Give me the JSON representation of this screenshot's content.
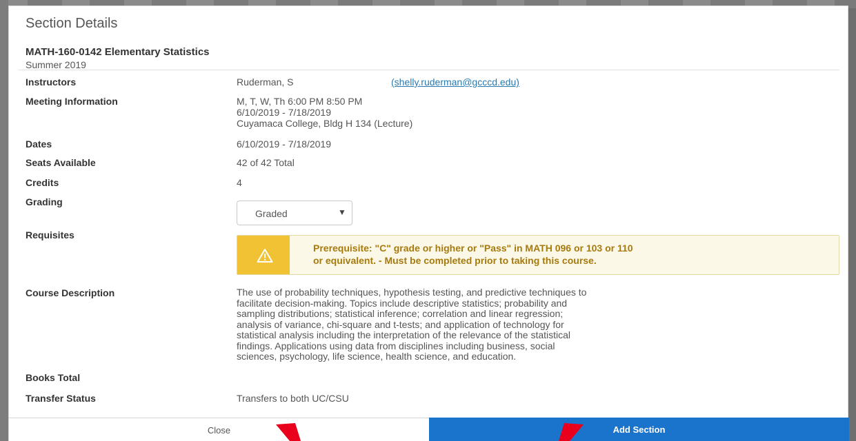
{
  "modal": {
    "title": "Section Details"
  },
  "section": {
    "name": "MATH-160-0142 Elementary Statistics",
    "term": "Summer 2019"
  },
  "details": {
    "instructors": {
      "label": "Instructors",
      "name": "Ruderman, S",
      "email": "(shelly.ruderman@gcccd.edu)"
    },
    "meeting": {
      "label": "Meeting Information",
      "line1": "M, T, W, Th 6:00 PM 8:50 PM",
      "line2": "6/10/2019 - 7/18/2019",
      "line3": "Cuyamaca College, Bldg H 134 (Lecture)"
    },
    "dates": {
      "label": "Dates",
      "value": "6/10/2019 - 7/18/2019"
    },
    "seats": {
      "label": "Seats Available",
      "value": "42 of 42 Total"
    },
    "credits": {
      "label": "Credits",
      "value": "4"
    },
    "grading": {
      "label": "Grading",
      "selected": "Graded"
    },
    "requisites": {
      "label": "Requisites",
      "line1": "Prerequisite: \"C\" grade or higher or \"Pass\" in MATH 096 or 103 or 110",
      "line2": "or equivalent. - Must be completed prior to taking this course."
    },
    "description": {
      "label": "Course Description",
      "lines": [
        "The use of probability techniques, hypothesis testing, and predictive techniques to",
        "facilitate decision-making. Topics include descriptive statistics; probability and",
        "sampling distributions; statistical inference; correlation and linear regression;",
        "analysis of variance, chi-square and t-tests; and application of technology for",
        "statistical analysis including the interpretation of the relevance of the statistical",
        "findings. Applications using data from disciplines including business, social",
        "sciences, psychology, life science, health science, and education."
      ]
    },
    "books": {
      "label": "Books Total"
    },
    "transfer": {
      "label": "Transfer Status",
      "value": "Transfers to both UC/CSU"
    }
  },
  "footer": {
    "close_label": "Close",
    "add_label": "Add Section"
  },
  "colors": {
    "primary_button": "#1b74cc",
    "warning_icon_bg": "#f0c234",
    "warning_text": "#a77a0c",
    "link": "#2a7ab0",
    "annotation_arrow": "#e8001c"
  },
  "icons": {
    "warning": "warning-triangle-icon",
    "dropdown": "caret-down-icon"
  }
}
